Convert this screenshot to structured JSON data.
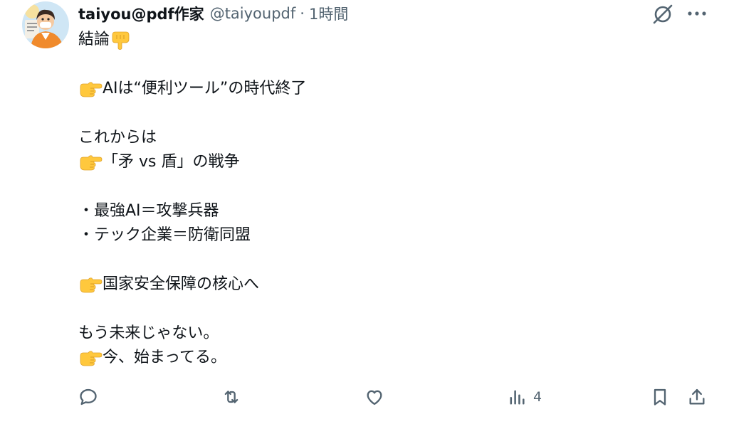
{
  "author": {
    "name": "taiyou@pdf作家",
    "handle": "@taiyoupdf",
    "separator": "·",
    "timestamp": "1時間"
  },
  "tweet": {
    "lines": [
      {
        "emoji": "point-down",
        "text": "結論"
      },
      {
        "emoji": "",
        "text": ""
      },
      {
        "emoji": "point-right",
        "text": "AIは“便利ツール”の時代終了"
      },
      {
        "emoji": "",
        "text": ""
      },
      {
        "emoji": "",
        "text": "これからは"
      },
      {
        "emoji": "point-right",
        "text": "「矛 vs 盾」の戦争"
      },
      {
        "emoji": "",
        "text": ""
      },
      {
        "emoji": "",
        "text": "・最強AI＝攻撃兵器"
      },
      {
        "emoji": "",
        "text": "・テック企業＝防衛同盟"
      },
      {
        "emoji": "",
        "text": ""
      },
      {
        "emoji": "point-right",
        "text": "国家安全保障の核心へ"
      },
      {
        "emoji": "",
        "text": ""
      },
      {
        "emoji": "",
        "text": "もう未来じゃない。"
      },
      {
        "emoji": "point-right",
        "text": "今、始まってる。"
      }
    ]
  },
  "actions": {
    "reply": {
      "icon": "reply-icon"
    },
    "retweet": {
      "icon": "retweet-icon"
    },
    "like": {
      "icon": "like-icon"
    },
    "views": {
      "icon": "views-icon",
      "count": "4"
    },
    "bookmark": {
      "icon": "bookmark-icon"
    },
    "share": {
      "icon": "share-icon"
    }
  },
  "colors": {
    "text": "#0f1419",
    "secondary": "#536471",
    "emoji": "#ffc83d"
  }
}
